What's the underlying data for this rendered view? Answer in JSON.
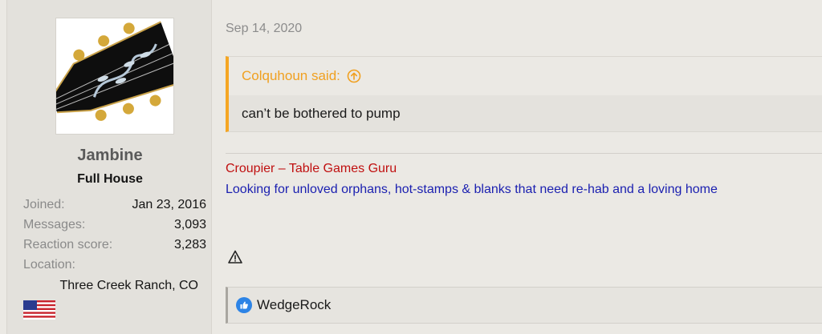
{
  "user": {
    "name": "Jambine",
    "title": "Full House",
    "stats": [
      {
        "label": "Joined:",
        "value": "Jan 23, 2016"
      },
      {
        "label": "Messages:",
        "value": "3,093"
      },
      {
        "label": "Reaction score:",
        "value": "3,283"
      },
      {
        "label": "Location:",
        "value": ""
      }
    ],
    "location": "Three Creek Ranch, CO"
  },
  "post": {
    "date": "Sep 14, 2020",
    "quote": {
      "author_line": "Colquhoun said:",
      "text": "can’t be bothered to pump",
      "accent_color": "#f0a020"
    },
    "signature": {
      "line1": "Croupier – Table Games Guru",
      "line1_color": "#c01010",
      "line2": "Looking for unloved orphans, hot-stamps & blanks that need re-hab and a loving home",
      "line2_color": "#1a1fb0"
    },
    "reactions": {
      "icon": "like-icon",
      "users": "WedgeRock"
    }
  }
}
